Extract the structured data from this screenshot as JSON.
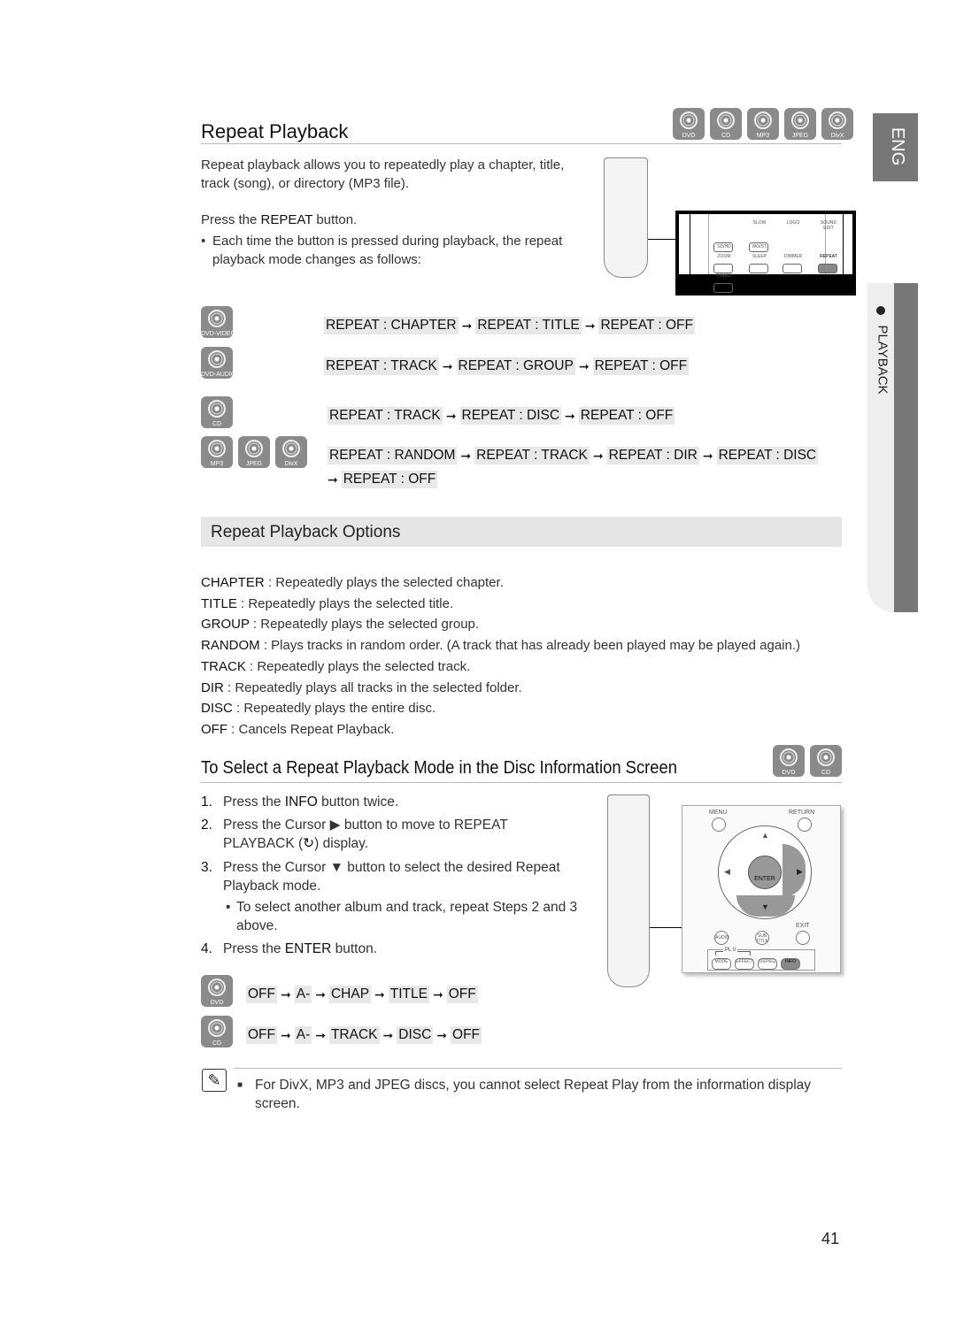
{
  "section_tab": "ENG",
  "chapter_tab": "PLAYBACK",
  "title": "Repeat Playback",
  "header_badges": [
    "DVD",
    "CD",
    "MP3",
    "JPEG",
    "DivX"
  ],
  "intro": "Repeat playback allows you to repeatedly play a chapter, title, track (song), or directory (MP3 file).",
  "press_prefix": "Press the ",
  "press_key": "REPEAT",
  "press_suffix": " button.",
  "bullet": "Each time the button is pressed during playback, the repeat playback mode changes as follows:",
  "remote1": {
    "labels": [
      "SD/HD",
      "MO/ST",
      "ZOOM",
      "SLEEP",
      "DIMMER",
      "REPEAT",
      "P.BASS",
      "SLOW",
      "LOGO",
      "SOUND EDIT"
    ]
  },
  "modes": [
    {
      "badges": [
        "DVD-VIDEO"
      ],
      "seq": [
        "REPEAT : CHAPTER",
        "REPEAT : TITLE",
        "REPEAT : OFF"
      ]
    },
    {
      "badges": [
        "DVD-AUDIO"
      ],
      "seq": [
        "REPEAT : TRACK",
        "REPEAT : GROUP",
        "REPEAT : OFF"
      ]
    },
    {
      "badges": [
        "CD"
      ],
      "seq": [
        "REPEAT : TRACK",
        "REPEAT : DISC",
        "REPEAT : OFF"
      ]
    },
    {
      "badges": [
        "MP3",
        "JPEG",
        "DivX"
      ],
      "seq": [
        "REPEAT : RANDOM",
        "REPEAT : TRACK",
        "REPEAT : DIR",
        "REPEAT : DISC"
      ],
      "seq2": [
        "REPEAT : OFF"
      ]
    }
  ],
  "options_title": "Repeat Playback Options",
  "options": [
    {
      "k": "CHAPTER",
      "v": " : Repeatedly plays the selected chapter."
    },
    {
      "k": "TITLE",
      "v": " : Repeatedly plays the selected title."
    },
    {
      "k": "GROUP",
      "v": " : Repeatedly plays the selected group."
    },
    {
      "k": "RANDOM",
      "v": " : Plays tracks in random order. (A track that has already been played may be played again.)"
    },
    {
      "k": "TRACK",
      "v": " : Repeatedly plays the selected track."
    },
    {
      "k": "DIR",
      "v": " : Repeatedly plays all tracks in the selected folder."
    },
    {
      "k": "DISC",
      "v": " : Repeatedly plays the entire disc."
    },
    {
      "k": "OFF",
      "v": " : Cancels Repeat Playback."
    }
  ],
  "section2_title": "To Select a Repeat Playback Mode in the Disc Information Screen",
  "section2_badges": [
    "DVD",
    "CD"
  ],
  "steps": [
    {
      "n": "1.",
      "a": "Press the ",
      "k": "INFO",
      "b": " button twice."
    },
    {
      "n": "2.",
      "a": "Press the Cursor ▶ button to move to REPEAT PLAYBACK (",
      "k": "↻",
      "b": ") display."
    },
    {
      "n": "3.",
      "a": "Press the Cursor ▼ button to select the desired Repeat Playback mode.",
      "k": "",
      "b": ""
    },
    {
      "n": "4.",
      "a": "Press the ",
      "k": "ENTER",
      "b": " button."
    }
  ],
  "step3_bullet": "To select another album and track, repeat Steps 2 and 3 above.",
  "remote2": {
    "menu": "MENU",
    "return": "RETURN",
    "enter": "ENTER",
    "exit": "EXIT",
    "audio": "AUDIO",
    "subtitle": "SUB TITLE",
    "mode": "MODE",
    "effect": "EFFECT",
    "dsp": "DSP/EQ",
    "info": "INFO",
    "pl2": "PL II"
  },
  "info_modes": [
    {
      "badge": "DVD",
      "seq": [
        "OFF",
        "A-",
        "CHAP",
        "TITLE",
        "OFF"
      ]
    },
    {
      "badge": "CD",
      "seq": [
        "OFF",
        "A-",
        "TRACK",
        "DISC",
        "OFF"
      ]
    }
  ],
  "note": "For DivX, MP3 and JPEG discs, you cannot select Repeat Play from the information display screen.",
  "page_number": "41"
}
